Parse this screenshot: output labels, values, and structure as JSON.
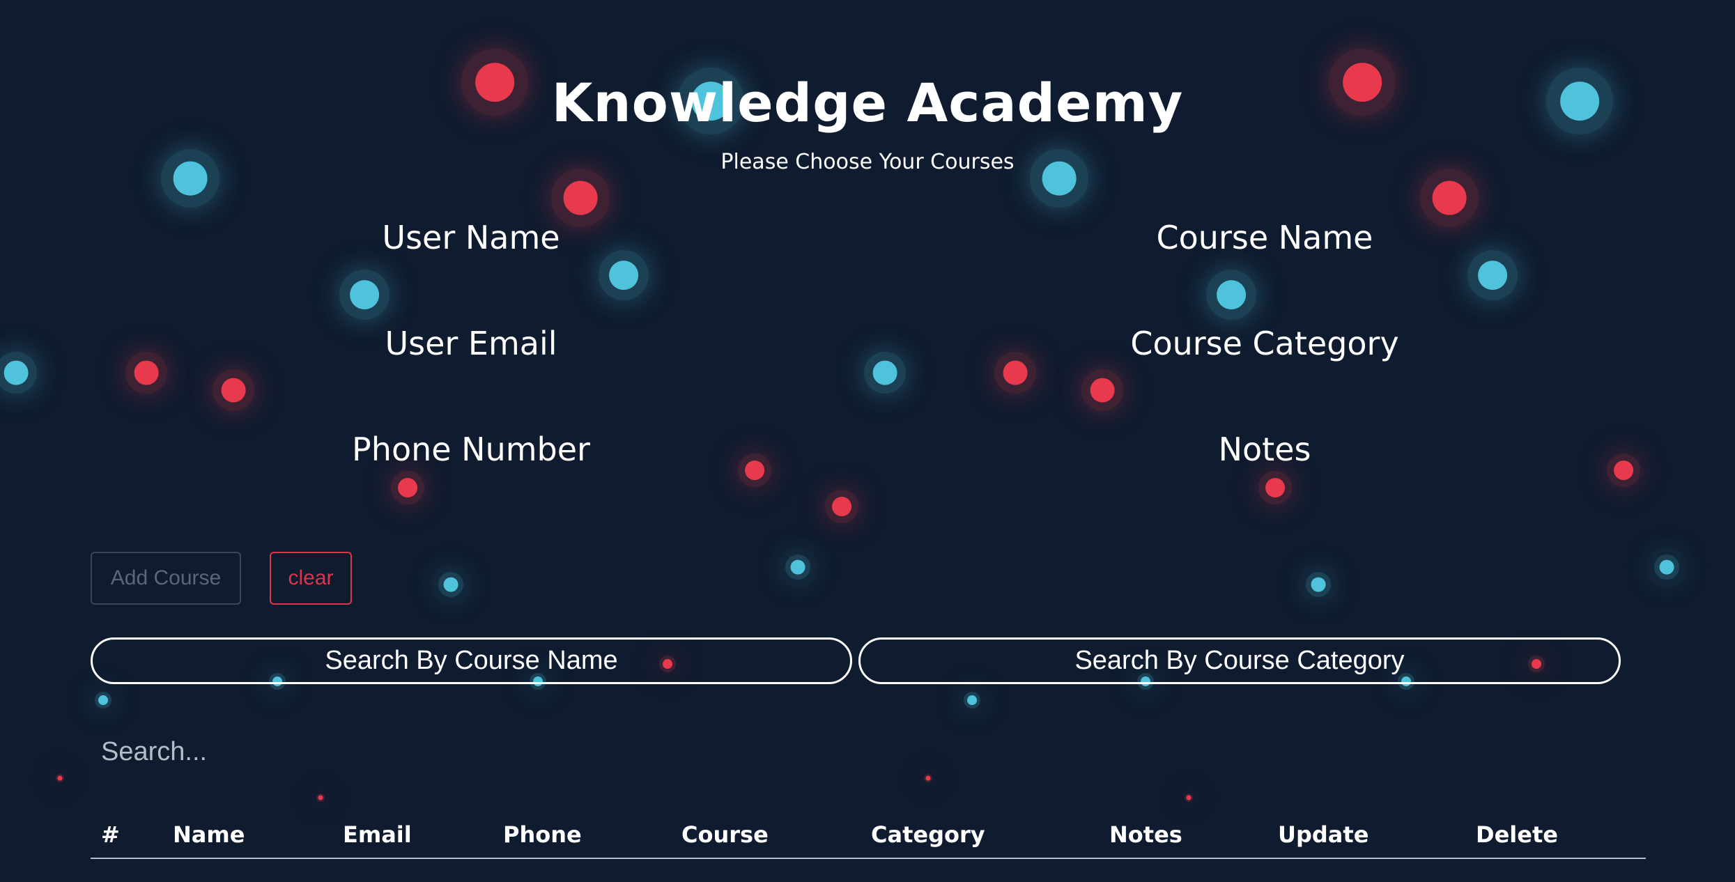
{
  "header": {
    "title": "Knowledge Academy",
    "subtitle": "Please Choose Your Courses"
  },
  "form": {
    "user_name_label": "User Name",
    "user_email_label": "User Email",
    "phone_label": "Phone Number",
    "course_name_label": "Course Name",
    "course_category_label": "Course Category",
    "notes_label": "Notes"
  },
  "actions": {
    "add_course_label": "Add Course",
    "clear_label": "clear"
  },
  "search": {
    "by_name_label": "Search By Course Name",
    "by_category_label": "Search By Course Category",
    "placeholder": "Search..."
  },
  "table": {
    "columns": [
      "#",
      "Name",
      "Email",
      "Phone",
      "Course",
      "Category",
      "Notes",
      "Update",
      "Delete"
    ]
  },
  "colors": {
    "background": "#0f1b2e",
    "accent_red": "#e8394d",
    "accent_blue": "#4fc3dc"
  }
}
